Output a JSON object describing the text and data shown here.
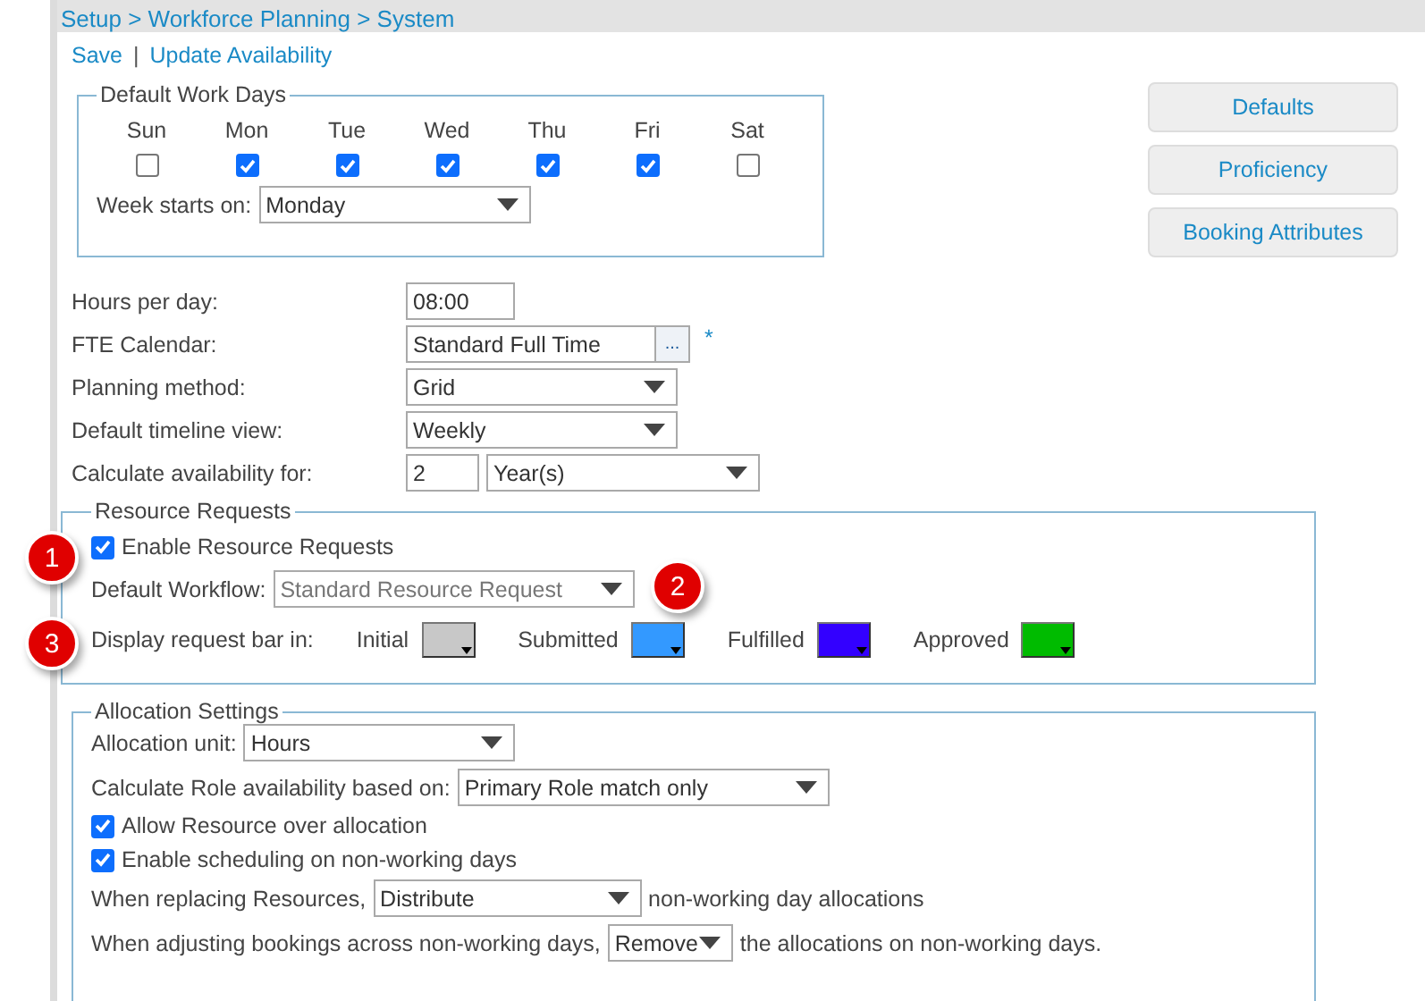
{
  "breadcrumb": "Setup > Workforce Planning > System",
  "actions": [
    {
      "label": "Save"
    },
    {
      "label": "Update Availability"
    }
  ],
  "action_separator": "|",
  "work_days": {
    "legend": "Default Work Days",
    "days": [
      {
        "label": "Sun",
        "checked": false
      },
      {
        "label": "Mon",
        "checked": true
      },
      {
        "label": "Tue",
        "checked": true
      },
      {
        "label": "Wed",
        "checked": true
      },
      {
        "label": "Thu",
        "checked": true
      },
      {
        "label": "Fri",
        "checked": true
      },
      {
        "label": "Sat",
        "checked": false
      }
    ],
    "week_start": {
      "label": "Week starts on:",
      "value": "Monday"
    }
  },
  "side_buttons": [
    {
      "label": "Defaults"
    },
    {
      "label": "Proficiency"
    },
    {
      "label": "Booking Attributes"
    }
  ],
  "fields": [
    {
      "kind": "text",
      "label": "Hours per day:",
      "value": "08:00"
    },
    {
      "kind": "lookup",
      "label": "FTE Calendar:",
      "value": "Standard Full Time",
      "button": "...",
      "required_mark": "*"
    },
    {
      "kind": "select",
      "label": "Planning method:",
      "value": "Grid"
    },
    {
      "kind": "select",
      "label": "Default timeline view:",
      "value": "Weekly"
    },
    {
      "kind": "number_unit",
      "label": "Calculate availability for:",
      "value": "2",
      "unit": "Year(s)"
    }
  ],
  "resource_requests": {
    "legend": "Resource Requests",
    "enable": {
      "label": "Enable Resource Requests",
      "checked": true
    },
    "workflow": {
      "label": "Default Workflow:",
      "value": "Standard Resource Request",
      "disabled": true
    },
    "bar_label": "Display request bar in:",
    "bar_colors": [
      {
        "label": "Initial",
        "color": "#c8c8c8"
      },
      {
        "label": "Submitted",
        "color": "#3399ff"
      },
      {
        "label": "Fulfilled",
        "color": "#3300ff"
      },
      {
        "label": "Approved",
        "color": "#00bb00"
      }
    ]
  },
  "callouts": [
    {
      "number": "1"
    },
    {
      "number": "2"
    },
    {
      "number": "3"
    }
  ],
  "allocation": {
    "legend": "Allocation Settings",
    "unit": {
      "label": "Allocation unit:",
      "value": "Hours"
    },
    "role": {
      "label": "Calculate Role availability based on:",
      "value": "Primary Role match only"
    },
    "checks": [
      {
        "label": "Allow Resource over allocation",
        "checked": true
      },
      {
        "label": "Enable scheduling on non-working days",
        "checked": true
      }
    ],
    "replacing": {
      "before": "When replacing Resources,",
      "value": "Distribute",
      "after": "non-working day allocations"
    },
    "adjusting": {
      "before": "When adjusting bookings across non-working days,",
      "value": "Remove",
      "after": "the allocations on non-working days."
    }
  }
}
